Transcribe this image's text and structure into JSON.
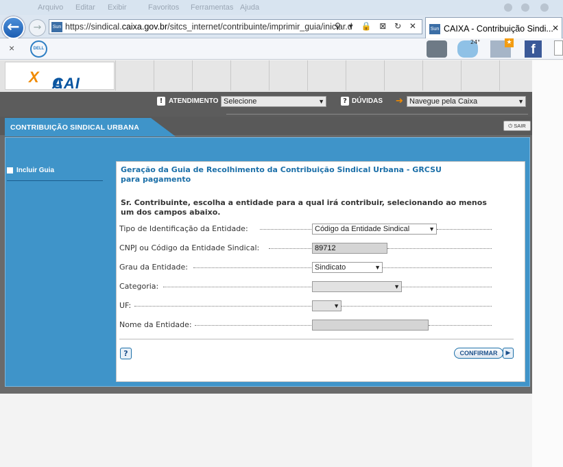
{
  "browser": {
    "menu_items": [
      "Arquivo",
      "Editar",
      "Exibir",
      "Favoritos",
      "Ferramentas",
      "Ajuda"
    ],
    "url_prefix": "https://sindical.",
    "url_domain": "caixa.gov.br",
    "url_path": "/sitcs_internet/contribuinte/imprimir_guia/iniciar.d",
    "url_tools": "⚲ ▾ 🔒 ⊠ ↻ ✕",
    "tab_title": "CAIXA - Contribuição Sindi...",
    "tab_close": "✕",
    "site_icon_text": "Sun",
    "close_favbar": "×",
    "dell_label": "DELL",
    "weather_temp": "24°",
    "facebook_label": "f"
  },
  "site": {
    "logo_main": "CAI",
    "logo_x": "X",
    "logo_tail": "A",
    "atendimento_label": "ATENDIMENTO",
    "atendimento_select": "Selecione",
    "duvidas_label": "DÚVIDAS",
    "navegue_select": "Navegue pela Caixa",
    "section_tab": "CONTRIBUIÇÃO SINDICAL URBANA",
    "sair_label": "SAIR",
    "sidebar_link": "Incluir Guia"
  },
  "form": {
    "title_line1": "Geração da Guia de Recolhimento da Contribuição Sindical Urbana - GRCSU",
    "title_line2": "para pagamento",
    "instruction_line1": "Sr. Contribuinte, escolha a entidade para a qual irá contribuir, selecionando ao menos",
    "instruction_line2": "um dos campos abaixo.",
    "tipo_label": "Tipo de Identificação da Entidade:",
    "tipo_value": "Código da Entidade Sindical",
    "cnpj_label": "CNPJ ou Código da Entidade Sindical:",
    "cnpj_value": "89712",
    "grau_label": "Grau da Entidade:",
    "grau_value": "Sindicato",
    "categoria_label": "Categoria:",
    "categoria_value": "",
    "uf_label": "UF:",
    "uf_value": "",
    "nome_label": "Nome da Entidade:",
    "nome_value": "",
    "help_label": "?",
    "confirm_label": "CONFIRMAR",
    "confirm_arrow": "▶"
  }
}
